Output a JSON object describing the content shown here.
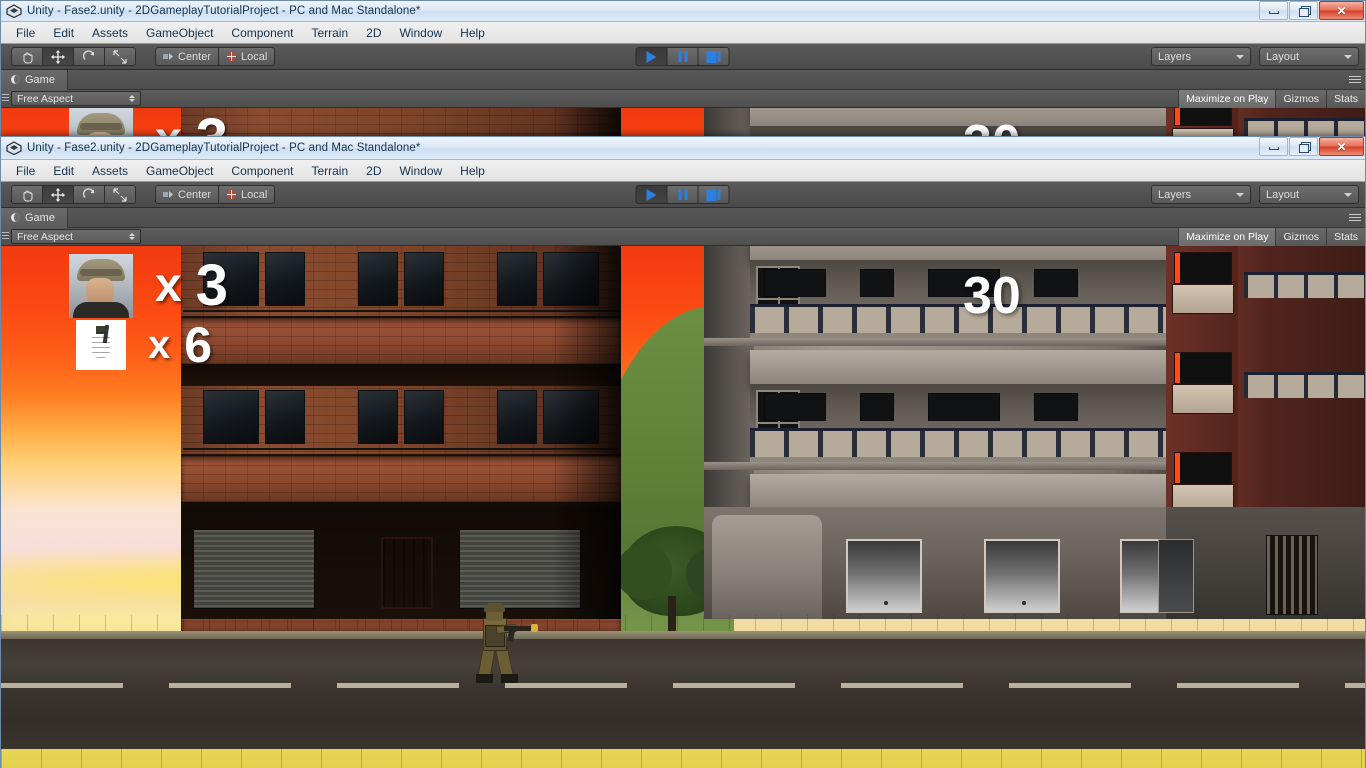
{
  "window": {
    "title": "Unity - Fase2.unity - 2DGameplayTutorialProject - PC and Mac Standalone*",
    "app_icon": "unity-logo-icon",
    "controls": {
      "minimize": "minimize-button",
      "restore": "restore-button",
      "close": "close-button",
      "close_glyph": "✕"
    }
  },
  "menubar": {
    "items": [
      {
        "label": "File"
      },
      {
        "label": "Edit"
      },
      {
        "label": "Assets"
      },
      {
        "label": "GameObject"
      },
      {
        "label": "Component"
      },
      {
        "label": "Terrain"
      },
      {
        "label": "2D"
      },
      {
        "label": "Window"
      },
      {
        "label": "Help"
      }
    ]
  },
  "toolbar": {
    "transform_tools": [
      {
        "name": "hand-tool",
        "active": false
      },
      {
        "name": "move-tool",
        "active": true
      },
      {
        "name": "rotate-tool",
        "active": false
      },
      {
        "name": "scale-tool",
        "active": false
      }
    ],
    "pivot": {
      "center_label": "Center",
      "local_label": "Local"
    },
    "playback": {
      "play_label": "play-button",
      "pause_label": "pause-button",
      "step_label": "step-button",
      "playing": true
    },
    "layers_label": "Layers",
    "layout_label": "Layout"
  },
  "dock": {
    "tab_label": "Game",
    "tab_icon": "game-view-icon"
  },
  "gameview_bar": {
    "aspect_label": "Free Aspect",
    "maximize_on_play": "Maximize on Play",
    "gizmos": "Gizmos",
    "stats": "Stats"
  },
  "hud": {
    "lives_icon": "soldier-portrait-icon",
    "lives_multiplier": "x",
    "lives_count": "3",
    "grenade_icon": "grenade-icon",
    "grenade_multiplier": "x",
    "grenade_count": "6",
    "ammo_count": "30"
  },
  "scene": {
    "description": "2D side-scroller street scene at sunset",
    "player": "soldier-player-character",
    "buildings": [
      "brick-apartment-building",
      "concrete-apartment-building",
      "maroon-apartment-building"
    ],
    "props": [
      "hill",
      "tree",
      "grass",
      "road",
      "sidewalk"
    ]
  },
  "colors": {
    "sky_top": "#f03a10",
    "sky_mid": "#ffb14a",
    "sky_bottom": "#e4d24e",
    "brick": "#8a4c30",
    "concrete": "#a59c92",
    "maroon": "#74352a",
    "road": "#3a352f",
    "hud_text": "#ffffff",
    "accent_blue": "#2a7fe0",
    "titlebar": "#dce8f5",
    "toolbar": "#4a4a4a"
  }
}
